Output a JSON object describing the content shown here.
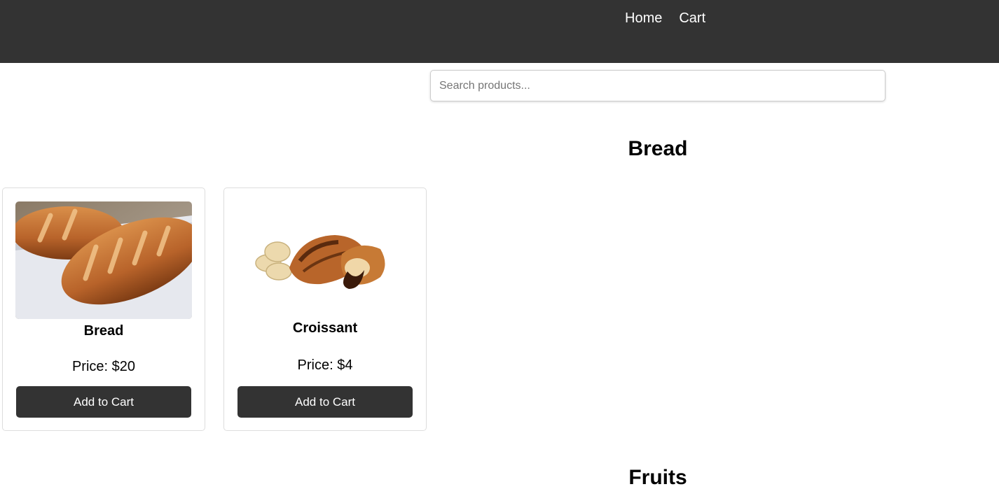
{
  "nav": {
    "home_label": "Home",
    "cart_label": "Cart"
  },
  "search": {
    "placeholder": "Search products..."
  },
  "sections": [
    {
      "title": "Bread",
      "products": [
        {
          "name": "Bread",
          "price": "Price: $20",
          "button_label": "Add to Cart",
          "image_icon": "bread-loaf-image"
        },
        {
          "name": "Croissant",
          "price": "Price: $4",
          "button_label": "Add to Cart",
          "image_icon": "croissant-image"
        }
      ]
    },
    {
      "title": "Fruits",
      "products": []
    }
  ],
  "colors": {
    "topbar": "#333333",
    "button": "#333333",
    "card_border": "#dddddd"
  }
}
